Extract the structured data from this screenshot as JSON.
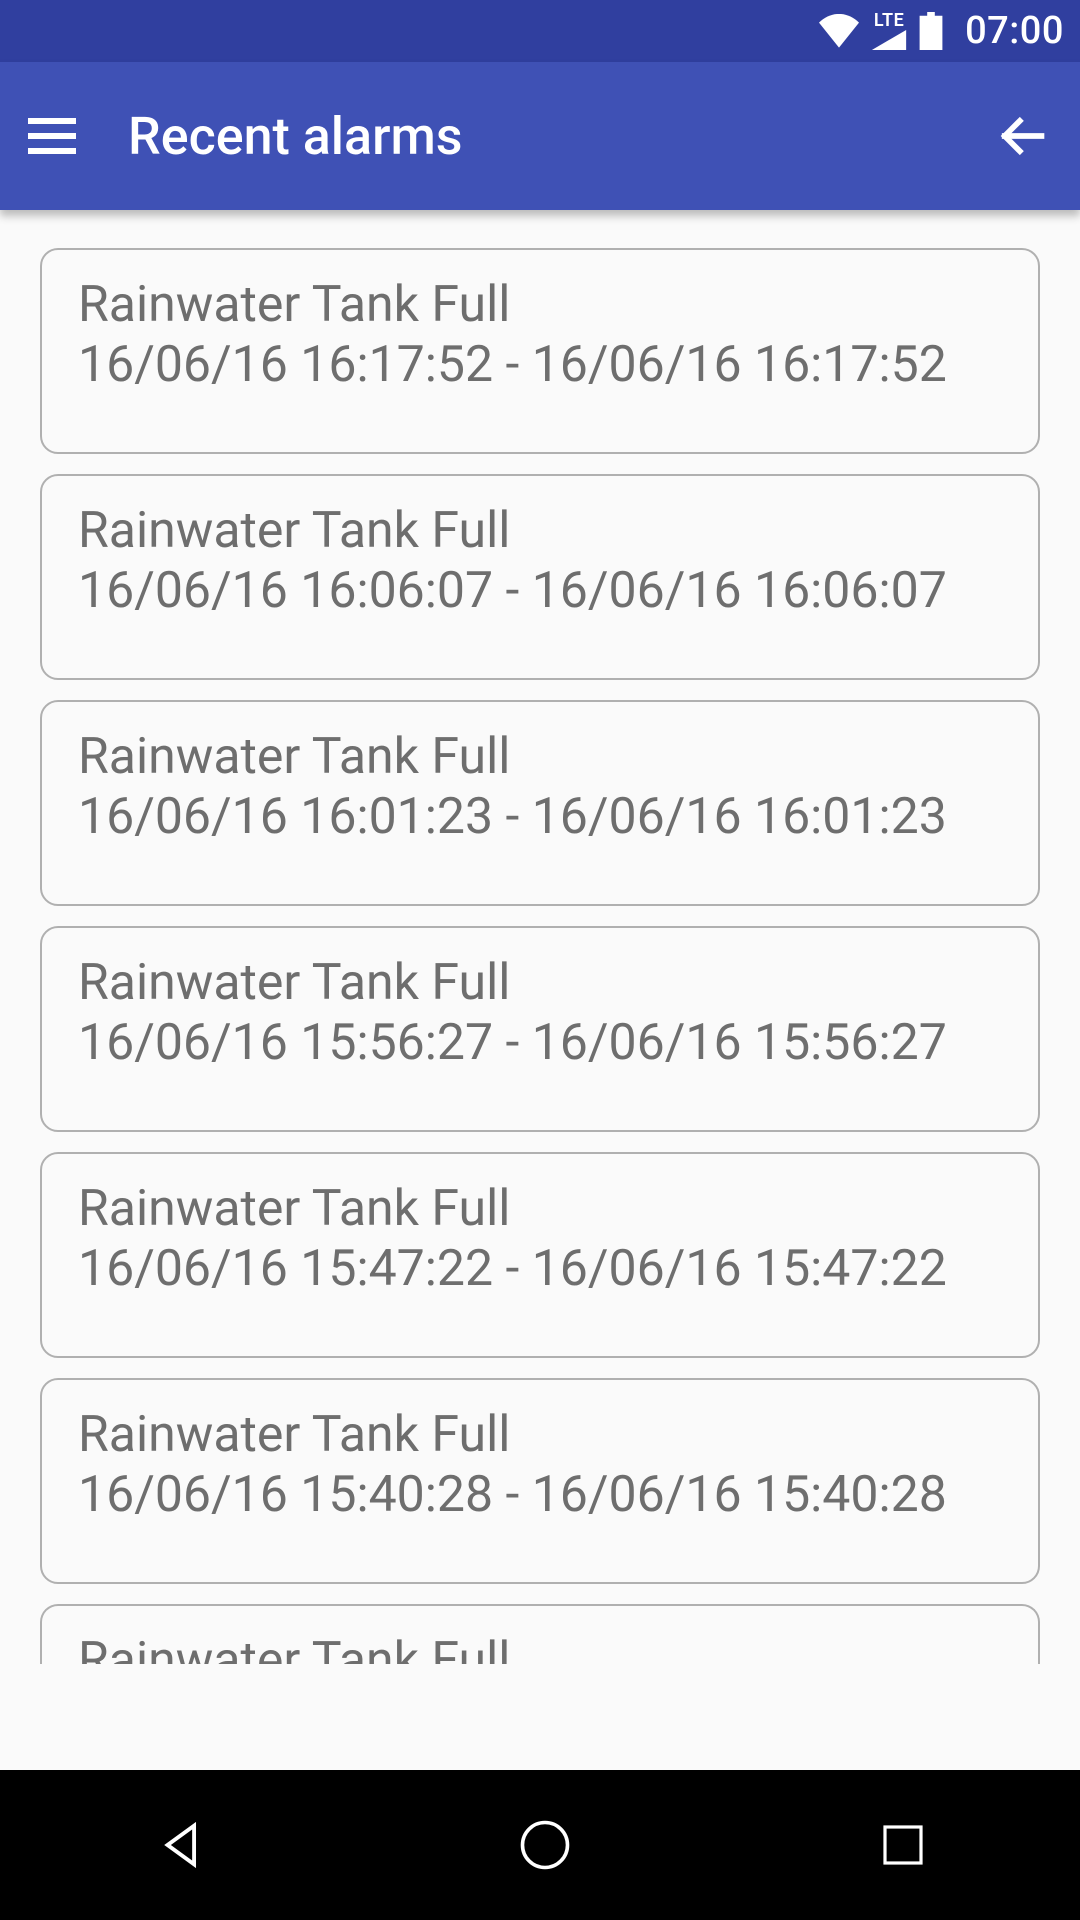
{
  "status": {
    "time": "07:00",
    "lte": "LTE"
  },
  "appbar": {
    "title": "Recent alarms"
  },
  "alarms": [
    {
      "title": "Rainwater Tank Full",
      "time": "16/06/16 16:17:52 - 16/06/16 16:17:52"
    },
    {
      "title": "Rainwater Tank Full",
      "time": "16/06/16 16:06:07 - 16/06/16 16:06:07"
    },
    {
      "title": "Rainwater Tank Full",
      "time": "16/06/16 16:01:23 - 16/06/16 16:01:23"
    },
    {
      "title": "Rainwater Tank Full",
      "time": "16/06/16 15:56:27 - 16/06/16 15:56:27"
    },
    {
      "title": "Rainwater Tank Full",
      "time": "16/06/16 15:47:22 - 16/06/16 15:47:22"
    },
    {
      "title": "Rainwater Tank Full",
      "time": "16/06/16 15:40:28 - 16/06/16 15:40:28"
    },
    {
      "title": "Rainwater Tank Full",
      "time": ""
    }
  ]
}
